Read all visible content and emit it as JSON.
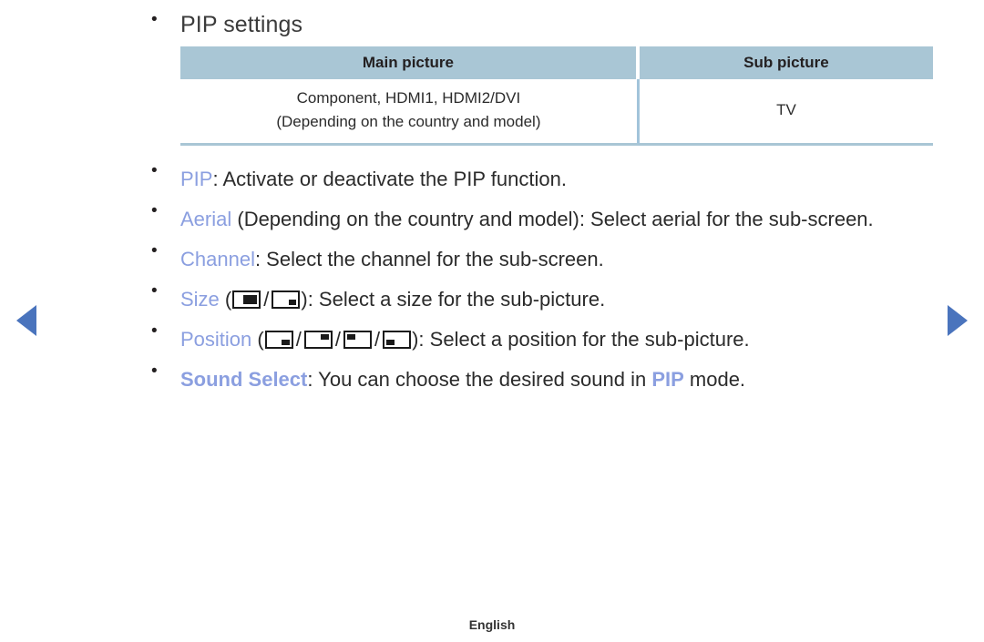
{
  "nav": {
    "prev_label": "◀",
    "next_label": "▶"
  },
  "heading": {
    "text": "PIP settings"
  },
  "table": {
    "columns": [
      "Main picture",
      "Sub picture"
    ],
    "rows": [
      {
        "main_line1": "Component, HDMI1, HDMI2/DVI",
        "main_line2": "(Depending on the country and model)",
        "sub": "TV"
      }
    ]
  },
  "items": {
    "pip": {
      "keyword": "PIP",
      "text": ": Activate or deactivate the PIP function."
    },
    "aerial": {
      "keyword": "Aerial",
      "text": " (Depending on the country and model): Select aerial for the sub-screen."
    },
    "channel": {
      "keyword": "Channel",
      "text": ": Select the channel for the sub-screen."
    },
    "size": {
      "keyword": "Size",
      "open": " (",
      "slash": "/",
      "close": "): Select a size for the sub-picture.",
      "icons": [
        "pip-size-large-icon",
        "pip-size-small-icon"
      ]
    },
    "position": {
      "keyword": "Position",
      "open": " (",
      "slash": "/",
      "close": "): Select a position for the sub-picture.",
      "icons": [
        "pip-position-bottom-right-icon",
        "pip-position-top-right-icon",
        "pip-position-top-left-icon",
        "pip-position-bottom-left-icon"
      ]
    },
    "sound_select": {
      "keyword": "Sound Select",
      "text_before": ": You can choose the desired sound in ",
      "keyword2": "PIP",
      "text_after": " mode."
    }
  },
  "footer": {
    "language": "English"
  },
  "colors": {
    "keyword": "#8b9fe0",
    "table_header_bg": "#a9c6d5",
    "nav_arrow": "#4a74bd",
    "body_text": "#2b2b2b"
  }
}
